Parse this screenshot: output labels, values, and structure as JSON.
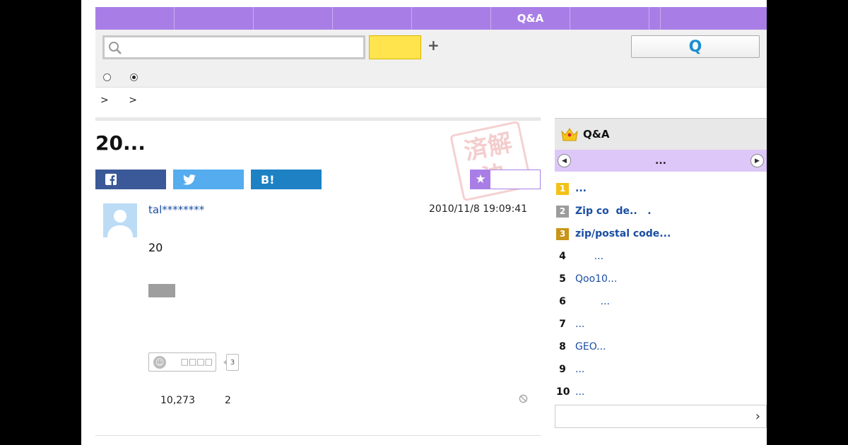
{
  "nav": {
    "tabs": [
      "",
      "",
      "",
      "",
      "",
      "Q&A",
      "",
      "",
      ""
    ]
  },
  "search": {
    "placeholder": "",
    "submit_label": "",
    "qa_button_label": "Q"
  },
  "breadcrumb": [
    ">",
    ">"
  ],
  "question": {
    "title": "20..."
  },
  "share": {
    "facebook_icon": "f",
    "twitter_icon": "twitter-bird",
    "hatena_label": "B!"
  },
  "stamp": {
    "text": "済解決"
  },
  "favorite": {
    "icon": "★"
  },
  "post": {
    "username": "tal********",
    "date": "2010/11/8  19:09:41",
    "body": "20",
    "reaction_label": "□□□□",
    "reaction_count": "3",
    "views": "10,273",
    "answers": "2"
  },
  "sidebar": {
    "title": "Q&A",
    "pager_label": "...",
    "rankings": [
      {
        "rank": "1",
        "text": "...",
        "bold": true,
        "badge_color": "#f3c218"
      },
      {
        "rank": "2",
        "text": "Zip co  de..   .",
        "bold": true,
        "badge_color": "#9c9c9c"
      },
      {
        "rank": "3",
        "text": "zip/postal code...",
        "bold": true,
        "badge_color": "#c8951a"
      },
      {
        "rank": "4",
        "text": "      ...",
        "bold": false
      },
      {
        "rank": "5",
        "text": "Qoo10...",
        "bold": false
      },
      {
        "rank": "6",
        "text": "        ...",
        "bold": false
      },
      {
        "rank": "7",
        "text": "...",
        "bold": false
      },
      {
        "rank": "8",
        "text": "GEO...",
        "bold": false
      },
      {
        "rank": "9",
        "text": "...",
        "bold": false
      },
      {
        "rank": "10",
        "text": "...",
        "bold": false
      }
    ],
    "more_icon": "›"
  },
  "colors": {
    "nav_purple": "#a87ee6",
    "search_yellow": "#ffe44d",
    "link_blue": "#1a4ea3"
  }
}
